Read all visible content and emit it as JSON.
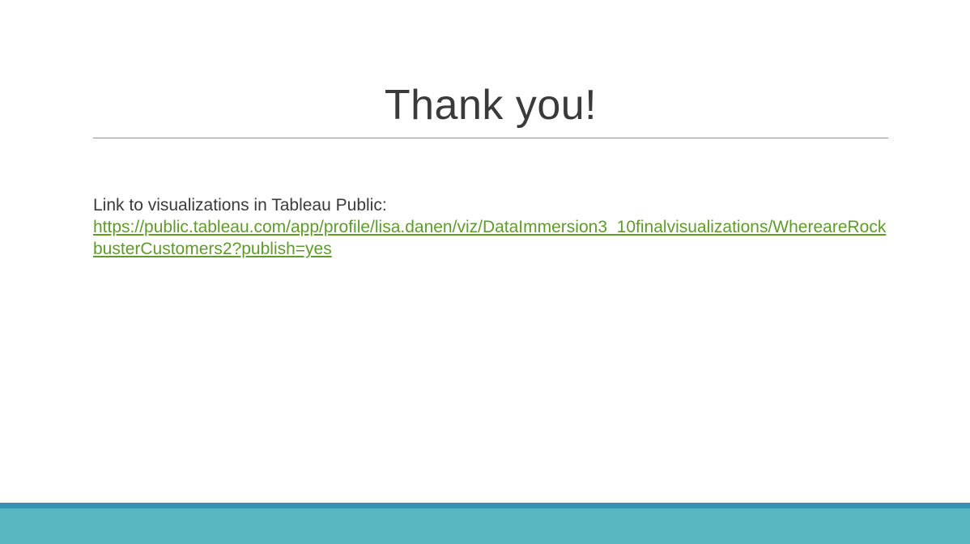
{
  "slide": {
    "title": "Thank you!",
    "intro_text": "Link to visualizations in Tableau Public:",
    "link_text": "https://public.tableau.com/app/profile/lisa.danen/viz/DataImmersion3_10finalvisualizations/WhereareRockbusterCustomers2?publish=yes"
  },
  "theme": {
    "title_color": "#3a3a3a",
    "link_color": "#5f9a2b",
    "footer_line_color": "#3592b5",
    "footer_band_color": "#58b6c0"
  }
}
